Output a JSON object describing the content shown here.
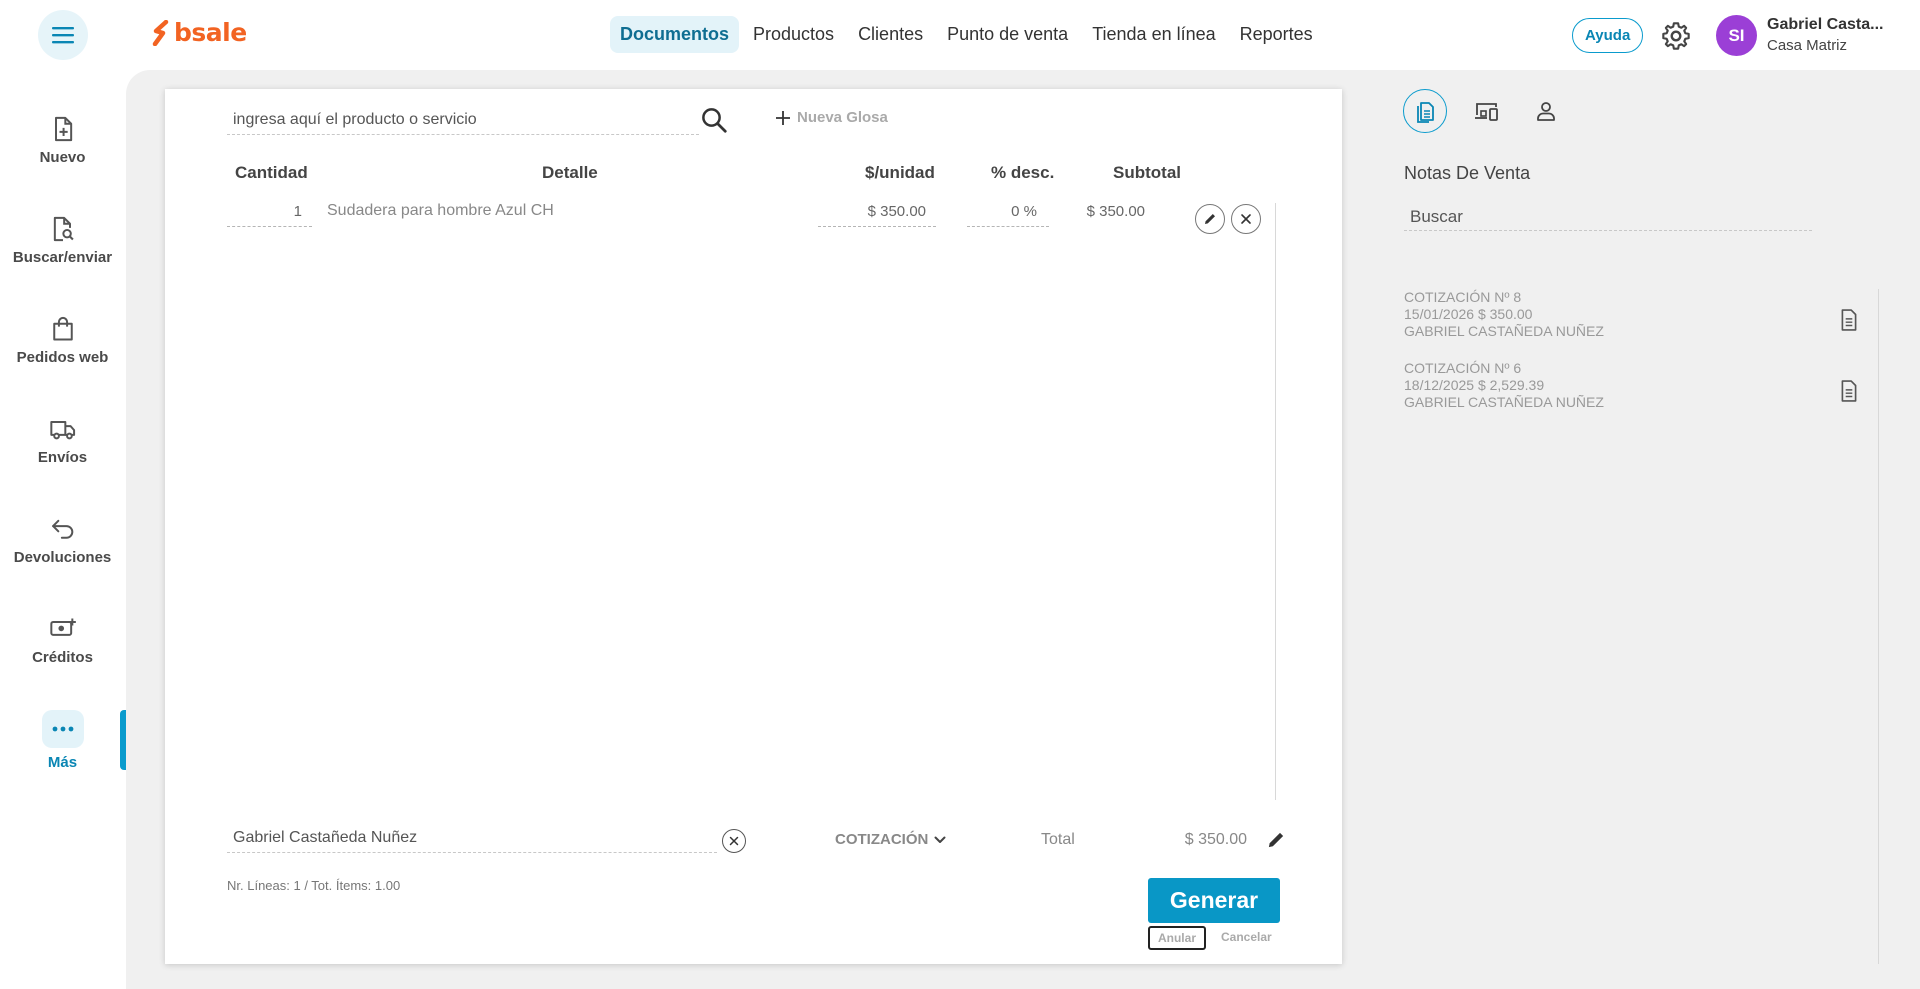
{
  "header": {
    "logo": "bsale",
    "nav": [
      "Documentos",
      "Productos",
      "Clientes",
      "Punto de venta",
      "Tienda en línea",
      "Reportes"
    ],
    "help_label": "Ayuda",
    "avatar_initials": "SI",
    "user_name": "Gabriel Casta...",
    "user_branch": "Casa Matriz",
    "accent_color": "#0a9bcd",
    "brand_color": "#f26322"
  },
  "sidebar": {
    "items": [
      {
        "label": "Nuevo",
        "icon": "new-document-icon"
      },
      {
        "label": "Buscar/enviar",
        "icon": "search-document-icon"
      },
      {
        "label": "Pedidos web",
        "icon": "shopping-bag-icon"
      },
      {
        "label": "Envíos",
        "icon": "truck-icon"
      },
      {
        "label": "Devoluciones",
        "icon": "return-arrow-icon"
      },
      {
        "label": "Créditos",
        "icon": "money-plus-icon"
      },
      {
        "label": "Más",
        "icon": "more-dots-icon"
      }
    ],
    "active": "Más"
  },
  "editor": {
    "search_placeholder": "ingresa aquí el producto o servicio",
    "nueva_glosa": "Nueva Glosa",
    "columns": {
      "qty": "Cantidad",
      "detail": "Detalle",
      "unit_price": "$/unidad",
      "discount": "% desc.",
      "subtotal": "Subtotal"
    },
    "rows": [
      {
        "qty": "1",
        "detail": "Sudadera para hombre Azul CH",
        "unit_price": "$ 350.00",
        "discount": "0 %",
        "subtotal": "$ 350.00"
      }
    ],
    "client": "Gabriel Castañeda Nuñez",
    "doc_type": "COTIZACIÓN",
    "total_label": "Total",
    "total_value": "$ 350.00",
    "stats": "Nr. Líneas: 1 / Tot. Ítems: 1.00",
    "generate_label": "Generar",
    "void_label": "Anular",
    "cancel_label": "Cancelar"
  },
  "right_panel": {
    "title": "Notas De Venta",
    "search_placeholder": "Buscar",
    "documents": [
      {
        "title": "COTIZACIÓN Nº 8",
        "date_amount": "15/01/2026 $ 350.00",
        "client": "GABRIEL CASTAÑEDA NUÑEZ"
      },
      {
        "title": "COTIZACIÓN Nº 6",
        "date_amount": "18/12/2025 $ 2,529.39",
        "client": "GABRIEL CASTAÑEDA NUÑEZ"
      }
    ]
  }
}
